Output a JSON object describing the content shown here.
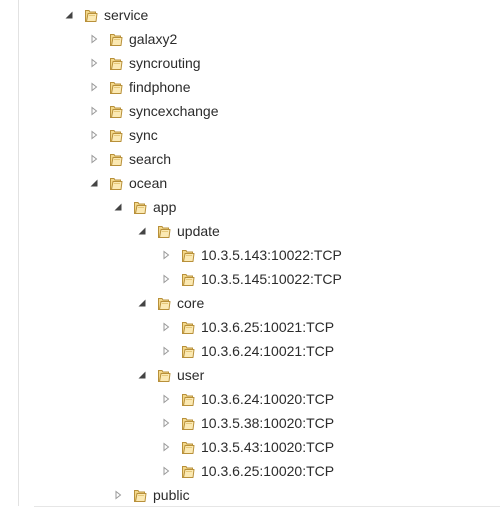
{
  "tree": {
    "service": {
      "label": "service",
      "expanded": true
    },
    "galaxy2": {
      "label": "galaxy2",
      "expanded": false
    },
    "syncrouting": {
      "label": "syncrouting",
      "expanded": false
    },
    "findphone": {
      "label": "findphone",
      "expanded": false
    },
    "syncexchange": {
      "label": "syncexchange",
      "expanded": false
    },
    "sync": {
      "label": "sync",
      "expanded": false
    },
    "search": {
      "label": "search",
      "expanded": false
    },
    "ocean": {
      "label": "ocean",
      "expanded": true
    },
    "app": {
      "label": "app",
      "expanded": true
    },
    "update": {
      "label": "update",
      "expanded": true
    },
    "update_nodes": [
      "10.3.5.143:10022:TCP",
      "10.3.5.145:10022:TCP"
    ],
    "core": {
      "label": "core",
      "expanded": true
    },
    "core_nodes": [
      "10.3.6.25:10021:TCP",
      "10.3.6.24:10021:TCP"
    ],
    "user": {
      "label": "user",
      "expanded": true
    },
    "user_nodes": [
      "10.3.6.24:10020:TCP",
      "10.3.5.38:10020:TCP",
      "10.3.5.43:10020:TCP",
      "10.3.6.25:10020:TCP"
    ],
    "public": {
      "label": "public",
      "expanded": false
    }
  },
  "icons": {
    "expanded": "expanded-arrow-icon",
    "collapsed": "collapsed-arrow-icon",
    "folder": "folder-icon"
  },
  "colors": {
    "folder_fill": "#f3d88a",
    "folder_stroke": "#b8903a",
    "arrow_expanded": "#444444",
    "arrow_collapsed": "#9a9a9a"
  }
}
